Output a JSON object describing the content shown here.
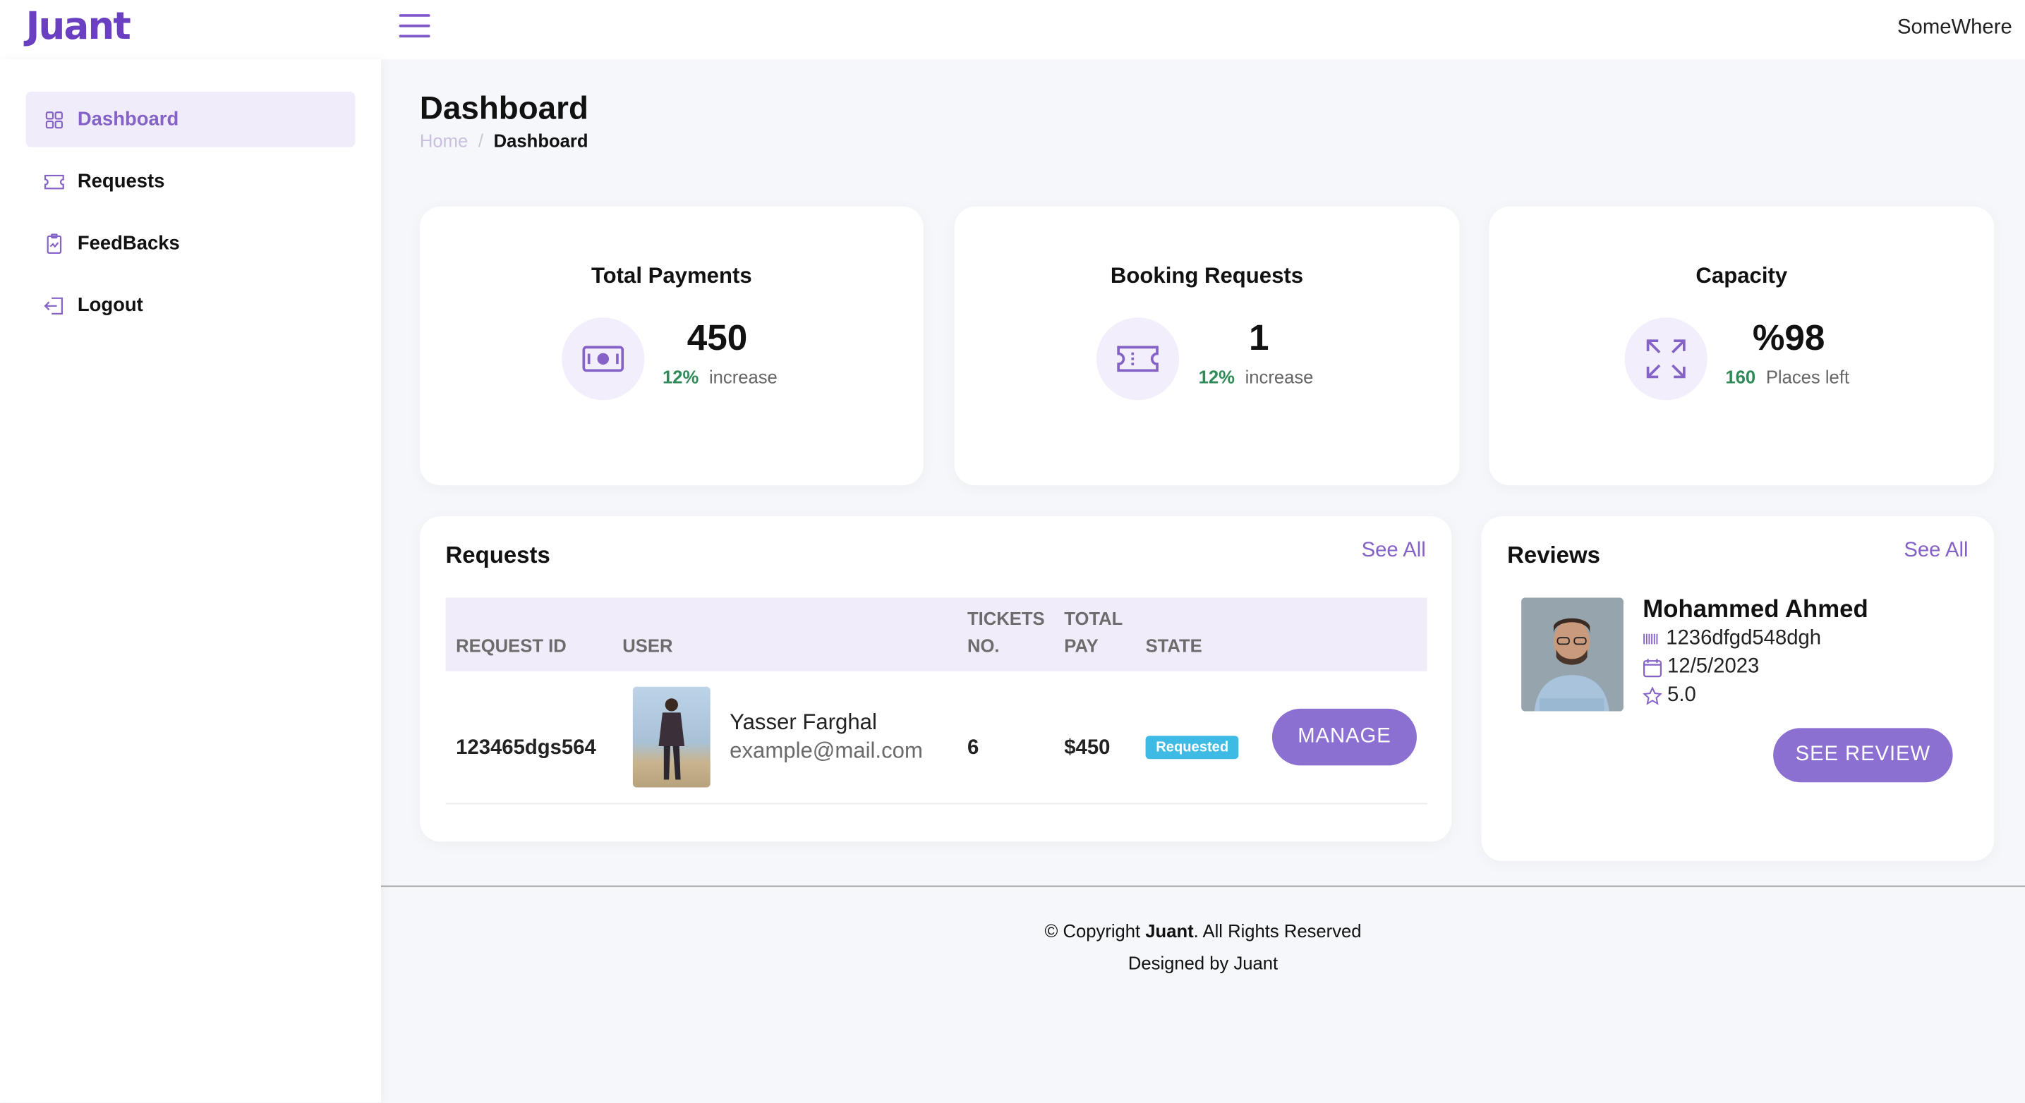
{
  "app": {
    "logo": "Juant",
    "top_right": "SomeWhere"
  },
  "sidebar": {
    "items": [
      {
        "label": "Dashboard",
        "icon": "grid-icon",
        "active": true
      },
      {
        "label": "Requests",
        "icon": "ticket-icon"
      },
      {
        "label": "FeedBacks",
        "icon": "feedback-clipboard-icon"
      },
      {
        "label": "Logout",
        "icon": "logout-icon"
      }
    ]
  },
  "header": {
    "title": "Dashboard",
    "breadcrumb": {
      "home": "Home",
      "separator": "/",
      "current": "Dashboard"
    }
  },
  "stats": [
    {
      "title": "Total Payments",
      "value": "450",
      "pct": "12%",
      "note": "increase",
      "icon": "cash-icon"
    },
    {
      "title": "Booking Requests",
      "value": "1",
      "pct": "12%",
      "note": "increase",
      "icon": "ticket-icon"
    },
    {
      "title": "Capacity",
      "value": "%98",
      "pct": "160",
      "note": "Places left",
      "icon": "expand-arrows-icon"
    }
  ],
  "requests": {
    "title": "Requests",
    "see_all": "See All",
    "columns": {
      "request_id": "REQUEST ID",
      "user": "USER",
      "tickets_1": "TICKETS",
      "tickets_2": "NO.",
      "total_1": "TOTAL",
      "total_2": "PAY",
      "state": "STATE"
    },
    "rows": [
      {
        "request_id": "123465dgs564",
        "user_name": "Yasser Farghal",
        "user_email": "example@mail.com",
        "tickets": "6",
        "total": "$450",
        "state": "Requested",
        "action": "MANAGE"
      }
    ]
  },
  "reviews": {
    "title": "Reviews",
    "see_all": "See All",
    "items": [
      {
        "name": "Mohammed Ahmed",
        "code": "1236dfgd548dgh",
        "date": "12/5/2023",
        "rating": "5.0",
        "action": "SEE REVIEW"
      }
    ]
  },
  "footer": {
    "copyright_prefix": "© Copyright",
    "brand": "Juant",
    "copyright_suffix": ". All Rights Reserved",
    "designed_by": "Designed by Juant"
  },
  "colors": {
    "brand": "#6a3fc2",
    "accent": "#8b6fd1",
    "active_bg": "#f1ecfa",
    "positive": "#2e8b57",
    "badge": "#3dbbe4"
  }
}
